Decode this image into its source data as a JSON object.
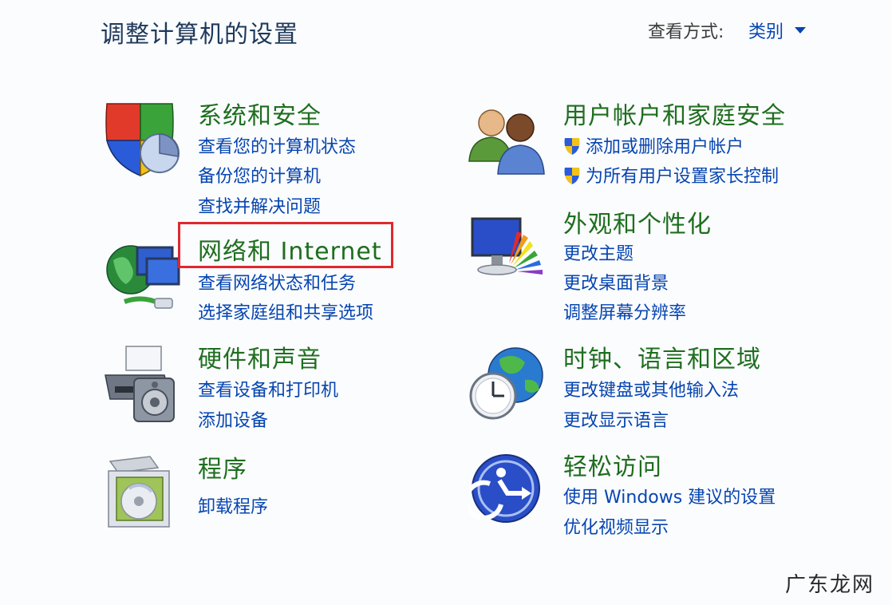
{
  "header": {
    "title": "调整计算机的设置",
    "view_by_label": "查看方式:",
    "view_by_value": "类别"
  },
  "categories": [
    {
      "title": "系统和安全",
      "icon": "system-security-shield-icon",
      "links": [
        "查看您的计算机状态",
        "备份您的计算机",
        "查找并解决问题"
      ]
    },
    {
      "title": "网络和 Internet",
      "icon": "network-globe-icon",
      "links": [
        "查看网络状态和任务",
        "选择家庭组和共享选项"
      ]
    },
    {
      "title": "硬件和声音",
      "icon": "printer-speaker-icon",
      "links": [
        "查看设备和打印机",
        "添加设备"
      ]
    },
    {
      "title": "程序",
      "icon": "programs-disc-icon",
      "links": [
        "卸载程序"
      ]
    },
    {
      "title": "用户帐户和家庭安全",
      "icon": "users-icon",
      "links": [
        "添加或删除用户帐户",
        "为所有用户设置家长控制"
      ]
    },
    {
      "title": "外观和个性化",
      "icon": "monitor-palette-icon",
      "links": [
        "更改主题",
        "更改桌面背景",
        "调整屏幕分辨率"
      ]
    },
    {
      "title": "时钟、语言和区域",
      "icon": "clock-globe-icon",
      "links": [
        "更改键盘或其他输入法",
        "更改显示语言"
      ]
    },
    {
      "title": "轻松访问",
      "icon": "ease-of-access-icon",
      "links": [
        "使用 Windows 建议的设置",
        "优化视频显示"
      ]
    }
  ],
  "colors": {
    "title_green": "#1e6e1e",
    "link_blue": "#0645b0",
    "highlight_red": "#e0282d"
  },
  "watermark": "广东龙网"
}
